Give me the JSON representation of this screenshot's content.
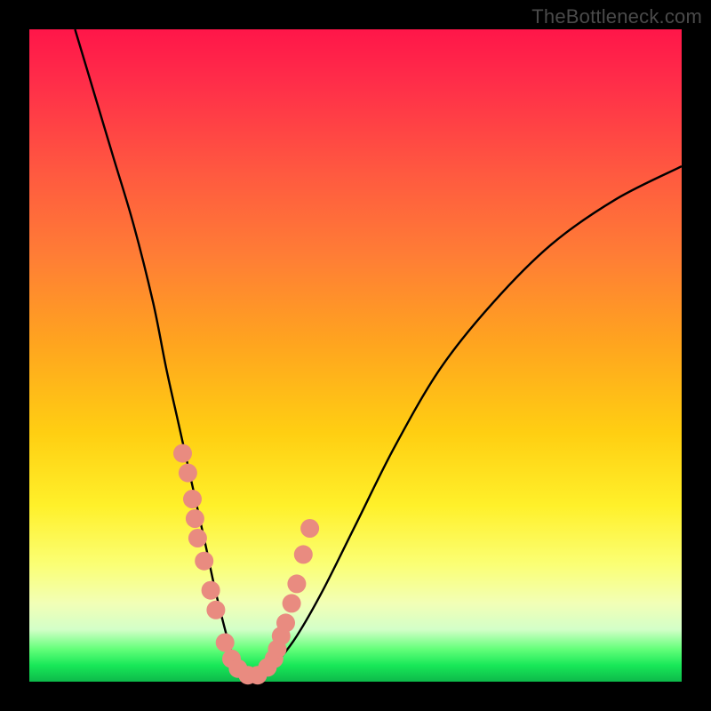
{
  "attribution": "TheBottleneck.com",
  "colors": {
    "frame": "#000000",
    "curve_stroke": "#000000",
    "dot_fill": "#e98b80",
    "gradient_top": "#ff1649",
    "gradient_bottom": "#0db94a"
  },
  "chart_data": {
    "type": "line",
    "title": "",
    "xlabel": "",
    "ylabel": "",
    "xlim": [
      0,
      100
    ],
    "ylim": [
      0,
      100
    ],
    "series": [
      {
        "name": "bottleneck-curve",
        "x": [
          7,
          10,
          13,
          16,
          19,
          21,
          23,
          25,
          27,
          28.5,
          30,
          31,
          32.5,
          34,
          36,
          38,
          41,
          45,
          50,
          56,
          63,
          71,
          80,
          90,
          100
        ],
        "values": [
          100,
          90,
          80,
          70,
          58,
          48,
          39,
          30,
          21,
          14,
          8,
          4.5,
          1.8,
          0.5,
          0.8,
          3,
          7,
          14,
          24,
          36,
          48,
          58,
          67,
          74,
          79
        ]
      }
    ],
    "highlight_dots": {
      "name": "sample-points",
      "x": [
        23.5,
        24.3,
        25.0,
        25.4,
        25.8,
        26.8,
        27.8,
        28.6,
        30.0,
        31.0,
        32.0,
        33.5,
        35.0,
        36.5,
        37.5,
        38.0,
        38.6,
        39.3,
        40.2,
        41.0,
        42.0,
        43.0
      ],
      "values": [
        35.0,
        32.0,
        28.0,
        25.0,
        22.0,
        18.5,
        14.0,
        11.0,
        6.0,
        3.5,
        2.0,
        1.0,
        1.0,
        2.2,
        3.5,
        5.0,
        7.0,
        9.0,
        12.0,
        15.0,
        19.5,
        23.5
      ]
    }
  }
}
